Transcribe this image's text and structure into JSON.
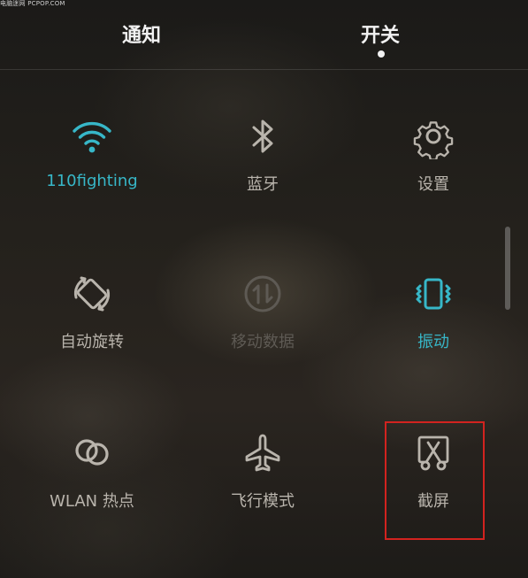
{
  "watermark": "电脑迷网 PCPOP.COM",
  "tabs": [
    {
      "label": "通知",
      "selected": false
    },
    {
      "label": "开关",
      "selected": true
    }
  ],
  "toggles": [
    {
      "label": "110fighting",
      "icon": "wifi-icon",
      "state": "active"
    },
    {
      "label": "蓝牙",
      "icon": "bluetooth-icon",
      "state": "off"
    },
    {
      "label": "设置",
      "icon": "gear-icon",
      "state": "off"
    },
    {
      "label": "自动旋转",
      "icon": "auto-rotate-icon",
      "state": "off"
    },
    {
      "label": "移动数据",
      "icon": "mobile-data-icon",
      "state": "disabled"
    },
    {
      "label": "振动",
      "icon": "vibrate-icon",
      "state": "active"
    },
    {
      "label": "WLAN 热点",
      "icon": "hotspot-icon",
      "state": "off"
    },
    {
      "label": "飞行模式",
      "icon": "airplane-icon",
      "state": "off"
    },
    {
      "label": "截屏",
      "icon": "screenshot-icon",
      "state": "off"
    }
  ],
  "colors": {
    "active": "#37b7c8",
    "inactive": "#b9b4ac",
    "disabled": "#5e5a54",
    "highlight": "#d2231f"
  }
}
